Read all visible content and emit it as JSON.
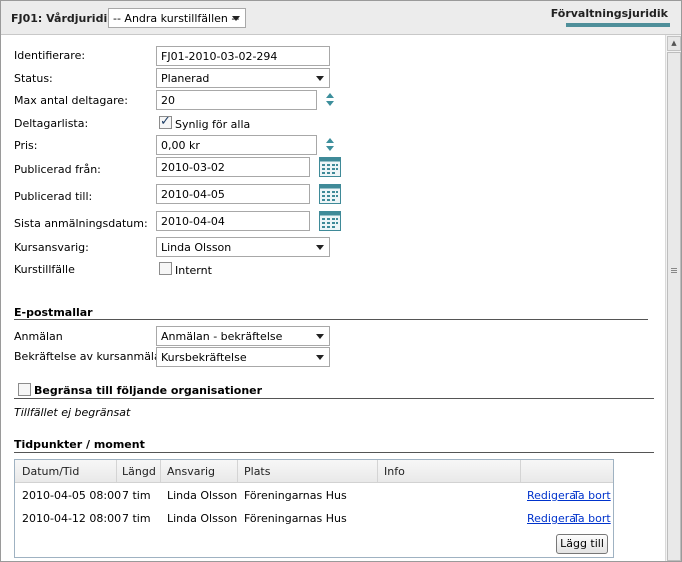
{
  "header": {
    "title": "FJ01: Vårdjuridik",
    "course_select": "-- Andra kurstillfällen --",
    "right_title": "Förvaltningsjuridik",
    "accent_color": "#4f8f9a"
  },
  "form": {
    "identifier": {
      "label": "Identifierare:",
      "value": "FJ01-2010-03-02-294"
    },
    "status": {
      "label": "Status:",
      "value": "Planerad"
    },
    "max_participants": {
      "label": "Max antal deltagare:",
      "value": "20"
    },
    "participant_list": {
      "label": "Deltagarlista:",
      "checkbox_label": "Synlig för alla",
      "checked": true
    },
    "price": {
      "label": "Pris:",
      "value": "0,00 kr"
    },
    "published_from": {
      "label": "Publicerad från:",
      "value": "2010-03-02"
    },
    "published_to": {
      "label": "Publicerad till:",
      "value": "2010-04-05"
    },
    "last_signup": {
      "label": "Sista anmälningsdatum:",
      "value": "2010-04-04"
    },
    "course_responsible": {
      "label": "Kursansvarig:",
      "value": "Linda Olsson"
    },
    "course_instance": {
      "label": "Kurstillfälle",
      "checkbox_label": "Internt",
      "checked": false
    }
  },
  "email_templates": {
    "section_title": "E-postmallar",
    "signup": {
      "label": "Anmälan",
      "value": "Anmälan - bekräftelse"
    },
    "confirmation": {
      "label": "Bekräftelse av kursanmälan",
      "value": "Kursbekräftelse"
    }
  },
  "restrict": {
    "checkbox_label": "Begränsa till följande organisationer",
    "checked": false,
    "status_text": "Tillfället ej begränsat"
  },
  "schedule": {
    "section_title": "Tidpunkter / moment",
    "columns": [
      "Datum/Tid",
      "Längd",
      "Ansvarig",
      "Plats",
      "Info"
    ],
    "rows": [
      {
        "datetime": "2010-04-05 08:00",
        "length": "7 tim",
        "responsible": "Linda Olsson",
        "place": "Föreningarnas Hus",
        "info": "",
        "edit": "Redigera",
        "delete": "Ta bort"
      },
      {
        "datetime": "2010-04-12 08:00",
        "length": "7 tim",
        "responsible": "Linda Olsson",
        "place": "Föreningarnas Hus",
        "info": "",
        "edit": "Redigera",
        "delete": "Ta bort"
      }
    ],
    "add_button": "Lägg till"
  },
  "icons": {
    "calendar": "calendar-icon",
    "spinner": "spinner-arrows-icon",
    "dropdown": "chevron-down-icon",
    "scroll_up": "scroll-up-icon",
    "scroll_down": "scroll-down-icon"
  }
}
